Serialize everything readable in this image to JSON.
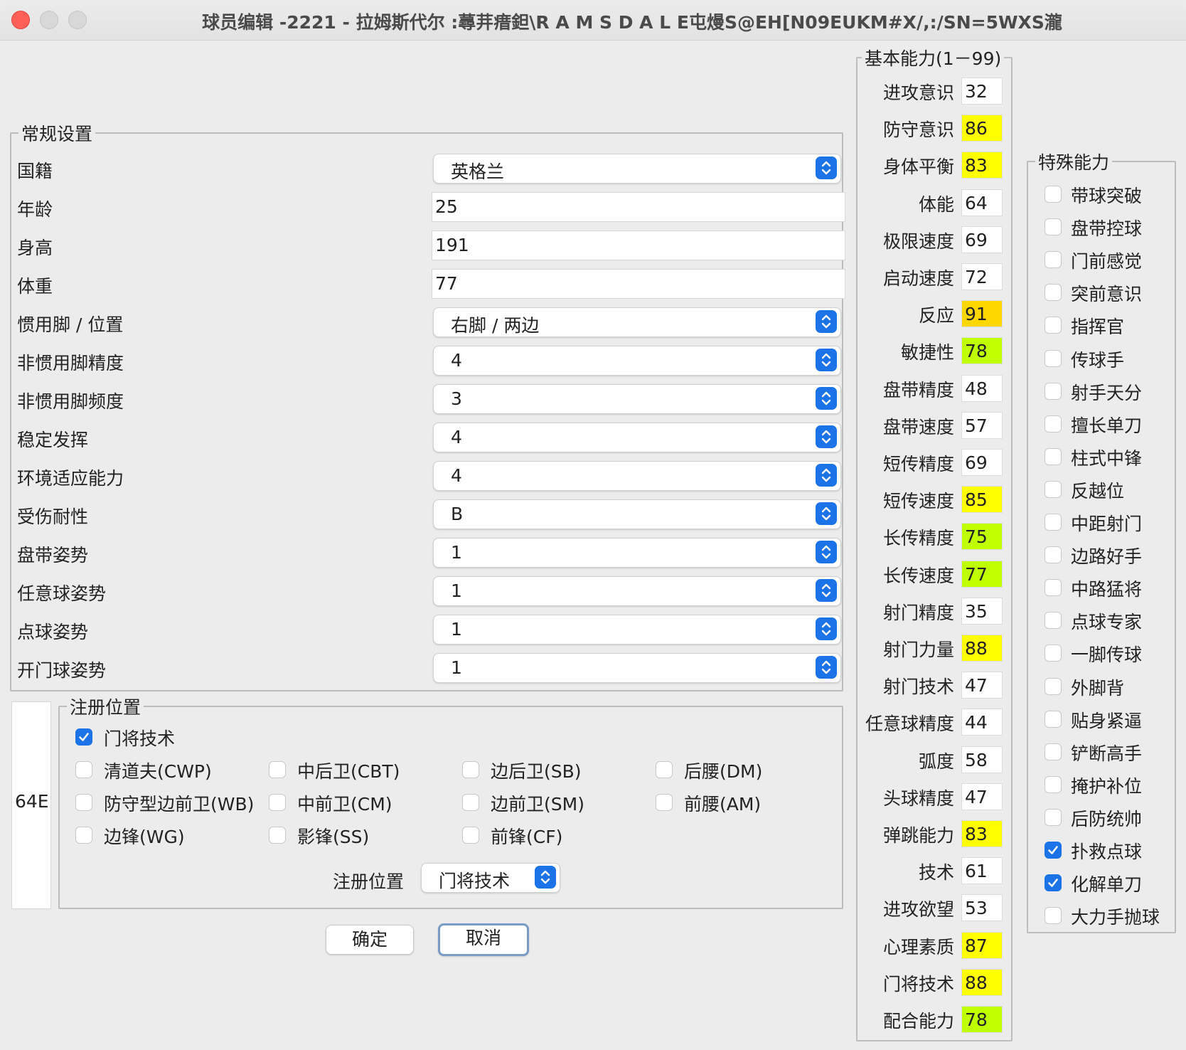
{
  "window": {
    "title": "球员编辑 -2221 - 拉姆斯代尔  :蕁茾瘄鉭\\R A M S D A L E屯熳S@EH[N09EUKM#X/,:/SN=5WXS瀧"
  },
  "general": {
    "title": "常规设置",
    "rows": [
      {
        "label": "国籍",
        "value": "英格兰",
        "kind": "select"
      },
      {
        "label": "年龄",
        "value": "25",
        "kind": "text"
      },
      {
        "label": "身高",
        "value": "191",
        "kind": "text"
      },
      {
        "label": "体重",
        "value": "77",
        "kind": "text"
      },
      {
        "label": "惯用脚 / 位置",
        "value": "右脚 / 两边",
        "kind": "select"
      },
      {
        "label": "非惯用脚精度",
        "value": "4",
        "kind": "select"
      },
      {
        "label": "非惯用脚频度",
        "value": "3",
        "kind": "select"
      },
      {
        "label": "稳定发挥",
        "value": "4",
        "kind": "select"
      },
      {
        "label": "环境适应能力",
        "value": "4",
        "kind": "select"
      },
      {
        "label": "受伤耐性",
        "value": "B",
        "kind": "select"
      },
      {
        "label": "盘带姿势",
        "value": "1",
        "kind": "select"
      },
      {
        "label": "任意球姿势",
        "value": "1",
        "kind": "select"
      },
      {
        "label": "点球姿势",
        "value": "1",
        "kind": "select"
      },
      {
        "label": "开门球姿势",
        "value": "1",
        "kind": "select"
      }
    ]
  },
  "position_badge": "64E",
  "registered": {
    "title": "注册位置",
    "options": [
      {
        "label": "门将技术",
        "checked": true
      },
      {
        "label": "清道夫(CWP)",
        "checked": false
      },
      {
        "label": "中后卫(CBT)",
        "checked": false
      },
      {
        "label": "边后卫(SB)",
        "checked": false
      },
      {
        "label": "后腰(DM)",
        "checked": false
      },
      {
        "label": "防守型边前卫(WB)",
        "checked": false
      },
      {
        "label": "中前卫(CM)",
        "checked": false
      },
      {
        "label": "边前卫(SM)",
        "checked": false
      },
      {
        "label": "前腰(AM)",
        "checked": false
      },
      {
        "label": "边锋(WG)",
        "checked": false
      },
      {
        "label": "影锋(SS)",
        "checked": false
      },
      {
        "label": "前锋(CF)",
        "checked": false
      }
    ],
    "select_label": "注册位置",
    "select_value": "门将技术"
  },
  "buttons": {
    "ok": "确定",
    "cancel": "取消"
  },
  "abilities": {
    "title": "基本能力(1－99)",
    "highlight_colors": {
      "yellow": "#ffff00",
      "orange": "#ffd700",
      "green": "#bfff00",
      "none": "#ffffff"
    },
    "items": [
      {
        "label": "进攻意识",
        "value": "32",
        "color": "none"
      },
      {
        "label": "防守意识",
        "value": "86",
        "color": "yellow"
      },
      {
        "label": "身体平衡",
        "value": "83",
        "color": "yellow"
      },
      {
        "label": "体能",
        "value": "64",
        "color": "none"
      },
      {
        "label": "极限速度",
        "value": "69",
        "color": "none"
      },
      {
        "label": "启动速度",
        "value": "72",
        "color": "none"
      },
      {
        "label": "反应",
        "value": "91",
        "color": "orange"
      },
      {
        "label": "敏捷性",
        "value": "78",
        "color": "green"
      },
      {
        "label": "盘带精度",
        "value": "48",
        "color": "none"
      },
      {
        "label": "盘带速度",
        "value": "57",
        "color": "none"
      },
      {
        "label": "短传精度",
        "value": "69",
        "color": "none"
      },
      {
        "label": "短传速度",
        "value": "85",
        "color": "yellow"
      },
      {
        "label": "长传精度",
        "value": "75",
        "color": "green"
      },
      {
        "label": "长传速度",
        "value": "77",
        "color": "green"
      },
      {
        "label": "射门精度",
        "value": "35",
        "color": "none"
      },
      {
        "label": "射门力量",
        "value": "88",
        "color": "yellow"
      },
      {
        "label": "射门技术",
        "value": "47",
        "color": "none"
      },
      {
        "label": "任意球精度",
        "value": "44",
        "color": "none"
      },
      {
        "label": "弧度",
        "value": "58",
        "color": "none"
      },
      {
        "label": "头球精度",
        "value": "47",
        "color": "none"
      },
      {
        "label": "弹跳能力",
        "value": "83",
        "color": "yellow"
      },
      {
        "label": "技术",
        "value": "61",
        "color": "none"
      },
      {
        "label": "进攻欲望",
        "value": "53",
        "color": "none"
      },
      {
        "label": "心理素质",
        "value": "87",
        "color": "yellow"
      },
      {
        "label": "门将技术",
        "value": "88",
        "color": "yellow"
      },
      {
        "label": "配合能力",
        "value": "78",
        "color": "green"
      }
    ]
  },
  "special": {
    "title": "特殊能力",
    "items": [
      {
        "label": "带球突破",
        "checked": false
      },
      {
        "label": "盘带控球",
        "checked": false
      },
      {
        "label": "门前感觉",
        "checked": false
      },
      {
        "label": "突前意识",
        "checked": false
      },
      {
        "label": "指挥官",
        "checked": false
      },
      {
        "label": "传球手",
        "checked": false
      },
      {
        "label": "射手天分",
        "checked": false
      },
      {
        "label": "擅长单刀",
        "checked": false
      },
      {
        "label": "柱式中锋",
        "checked": false
      },
      {
        "label": "反越位",
        "checked": false
      },
      {
        "label": "中距射门",
        "checked": false
      },
      {
        "label": "边路好手",
        "checked": false
      },
      {
        "label": "中路猛将",
        "checked": false
      },
      {
        "label": "点球专家",
        "checked": false
      },
      {
        "label": "一脚传球",
        "checked": false
      },
      {
        "label": "外脚背",
        "checked": false
      },
      {
        "label": "贴身紧逼",
        "checked": false
      },
      {
        "label": "铲断高手",
        "checked": false
      },
      {
        "label": "掩护补位",
        "checked": false
      },
      {
        "label": "后防统帅",
        "checked": false
      },
      {
        "label": "扑救点球",
        "checked": true
      },
      {
        "label": "化解单刀",
        "checked": true
      },
      {
        "label": "大力手抛球",
        "checked": false
      }
    ]
  }
}
